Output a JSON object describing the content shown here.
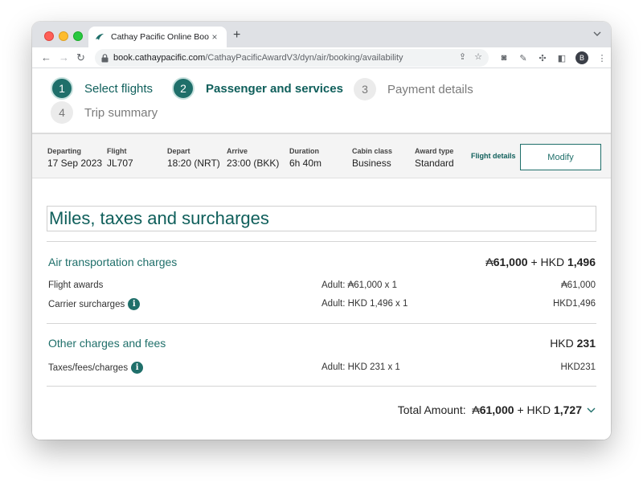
{
  "browser": {
    "tab_title": "Cathay Pacific Online Booking",
    "tab_close": "×",
    "new_tab": "+",
    "url_host": "book.cathaypacific.com",
    "url_path": "/CathayPacificAwardV3/dyn/air/booking/availability",
    "profile_initial": "B",
    "brand_color": "#1f6f6a"
  },
  "steps": [
    {
      "number": "1",
      "label": "Select flights",
      "state": "done"
    },
    {
      "number": "2",
      "label": "Passenger and services",
      "state": "current"
    },
    {
      "number": "3",
      "label": "Payment details",
      "state": "upcoming"
    },
    {
      "number": "4",
      "label": "Trip summary",
      "state": "upcoming"
    }
  ],
  "flight": {
    "departing_label": "Departing",
    "departing_value": "17 Sep 2023",
    "flight_label": "Flight",
    "flight_value": "JL707",
    "depart_label": "Depart",
    "depart_value": "18:20 (NRT)",
    "arrive_label": "Arrive",
    "arrive_value": "23:00 (BKK)",
    "duration_label": "Duration",
    "duration_value": "6h 40m",
    "cabin_label": "Cabin class",
    "cabin_value": "Business",
    "award_label": "Award type",
    "award_value": "Standard",
    "details_link": "Flight details",
    "modify_button": "Modify"
  },
  "charges": {
    "section_title": "Miles, taxes and surcharges",
    "air": {
      "title": "Air transportation charges",
      "total_miles": "61,000",
      "total_plus": "+ HKD",
      "total_hkd": "1,496",
      "rows": [
        {
          "label": "Flight awards",
          "detail": "Adult: ₳61,000 x 1",
          "amount": "₳61,000"
        },
        {
          "label": "Carrier surcharges",
          "detail": "Adult: HKD 1,496 x 1",
          "amount": "HKD1,496"
        }
      ]
    },
    "other": {
      "title": "Other charges and fees",
      "total_currency": "HKD",
      "total_hkd": "231",
      "rows": [
        {
          "label": "Taxes/fees/charges",
          "detail": "Adult: HKD 231 x 1",
          "amount": "HKD231"
        }
      ]
    },
    "total": {
      "label": "Total Amount:",
      "miles": "61,000",
      "plus": "+ HKD",
      "hkd": "1,727"
    },
    "miles_symbol": "₳"
  }
}
